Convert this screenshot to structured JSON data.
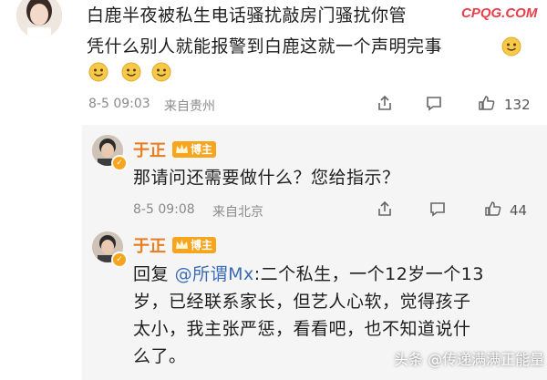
{
  "main_comment": {
    "line1": "白鹿半夜被私生电话骚扰敲房门骚扰你管",
    "line2": "凭什么别人就能报警到白鹿这就一个声明完事",
    "timestamp": "8-5 09:03",
    "location": "来自贵州",
    "like_count": "132"
  },
  "site_watermark": "CPQG.COM",
  "replies": [
    {
      "username": "于正",
      "badge": "博主",
      "text": "那请问还需要做什么？您给指示？",
      "timestamp": "8-5 09:08",
      "location": "来自北京",
      "like_count": "44"
    },
    {
      "username": "于正",
      "badge": "博主",
      "reply_prefix": "回复",
      "mention": "@所谓Mx",
      "text_line1": ":二个私生，一个12岁一个13",
      "text_line2": "岁，已经联系家长，但艺人心软，觉得孩子",
      "text_line3": "太小，我主张严惩，看看吧，也不知道说什",
      "text_line4": "么了。"
    }
  ],
  "footer_watermark": "头条 @传递满满正能量",
  "icons": [
    "share-icon",
    "comment-icon",
    "like-icon",
    "smile-emoji-icon",
    "crown-icon",
    "verified-icon"
  ],
  "colors": {
    "username": "#e87d1e",
    "badge": "#f7a41f",
    "mention": "#3b6bb6",
    "watermark": "#e8404a"
  }
}
